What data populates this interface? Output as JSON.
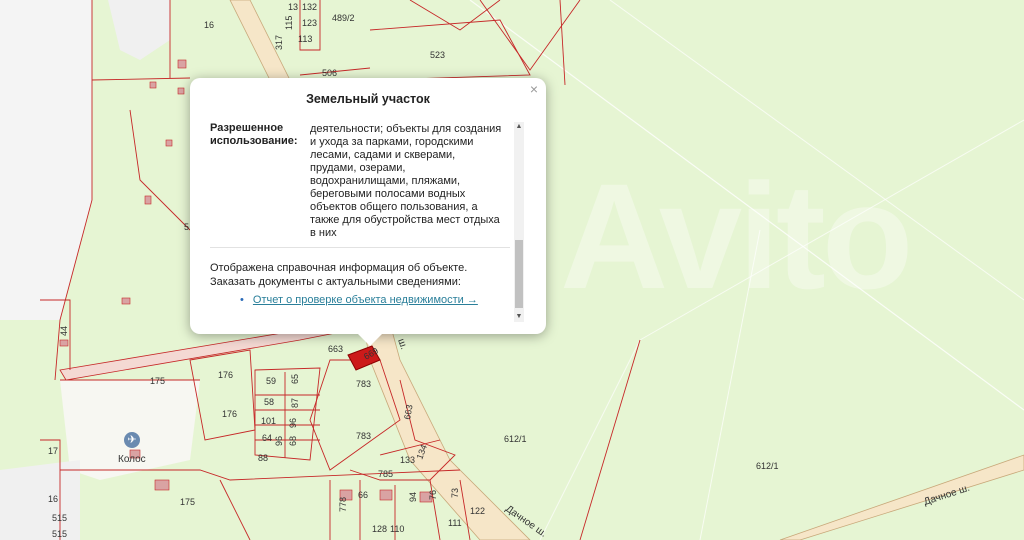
{
  "map": {
    "parcel_labels": [
      "16",
      "489/2",
      "132",
      "123",
      "113",
      "317",
      "115",
      "13",
      "523",
      "506",
      "663",
      "669",
      "783",
      "783",
      "663",
      "134",
      "133",
      "785",
      "612/1",
      "612/1",
      "175",
      "175",
      "176",
      "176",
      "59",
      "65",
      "58",
      "96",
      "87",
      "101",
      "68",
      "64",
      "96",
      "88",
      "44",
      "17",
      "16",
      "515",
      "515",
      "778",
      "66",
      "73",
      "76",
      "94",
      "110",
      "122",
      "111",
      "128",
      "5"
    ],
    "road_labels": [
      "Дачное ш.",
      "Дачное ш.",
      "ш."
    ],
    "poi_label": "Колос",
    "watermark": "Avito"
  },
  "popup": {
    "title": "Земельный участок",
    "close_symbol": "×",
    "field_label_line1": "Разрешенное",
    "field_label_line2": "использование",
    "field_value": "деятельности; объекты для создания и ухода за парками, городскими лесами, садами и скверами, прудами, озерами, водохранилищами, пляжами, береговыми полосами водных объектов общего пользования, а также для обустройства мест отдыха в них",
    "info_line1": "Отображена справочная информация об объекте.",
    "info_line2": "Заказать документы с актуальными сведениями:",
    "link_text": "Отчет о проверке объекта недвижимости →"
  },
  "colors": {
    "background": "#e6f5d3",
    "boundary": "#c62828",
    "road": "#f6e6c8",
    "selected_parcel": "#cc1a1a"
  }
}
